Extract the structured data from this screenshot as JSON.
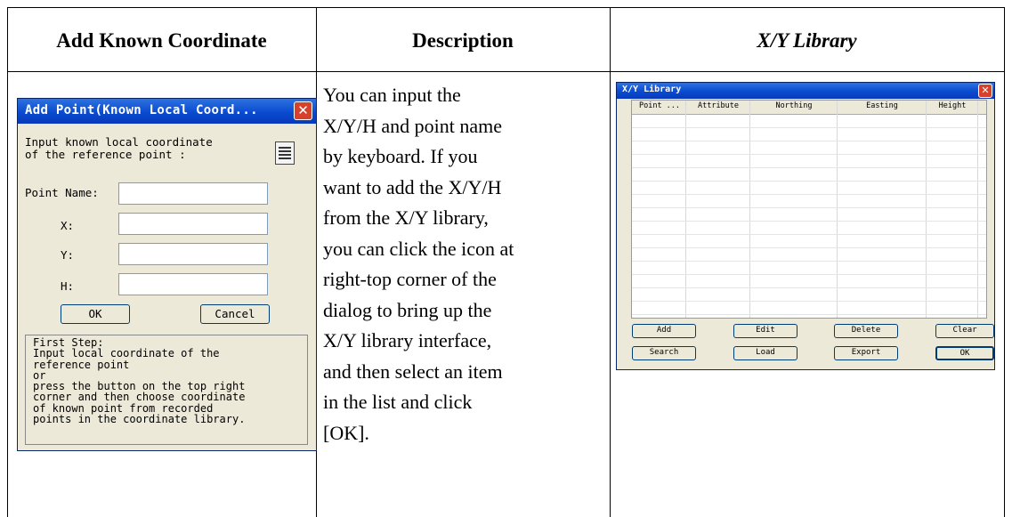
{
  "table": {
    "headers": [
      "Add Known Coordinate",
      "Description",
      "X/Y Library"
    ]
  },
  "description_lines": [
    "You can input the",
    "X/Y/H and point name",
    "by keyboard. If you",
    "want to add the X/Y/H",
    "from the X/Y library,",
    "you can click the icon at",
    "right-top corner of the",
    "dialog to bring up the",
    "X/Y library interface,",
    "and then select an item",
    "in the list and click",
    "[OK]."
  ],
  "add_point_dialog": {
    "title": "Add Point(Known Local Coord...",
    "prompt_lines": [
      "Input known local coordinate",
      "of the reference point :"
    ],
    "icon": "library-list-icon",
    "fields": [
      {
        "label": "Point Name:",
        "value": ""
      },
      {
        "label": "X:",
        "value": ""
      },
      {
        "label": "Y:",
        "value": ""
      },
      {
        "label": "H:",
        "value": ""
      }
    ],
    "ok_label": "OK",
    "cancel_label": "Cancel",
    "note_lines": [
      "First Step:",
      "Input local coordinate of the",
      "reference point",
      "or",
      "press the button on the top right",
      "corner and then choose coordinate",
      "of known point from recorded",
      "points in the coordinate library."
    ]
  },
  "library_dialog": {
    "title": "X/Y Library",
    "columns": [
      "Point ...",
      "Attribute",
      "Northing",
      "Easting",
      "Height"
    ],
    "buttons_row1": [
      "Add",
      "Edit",
      "Delete",
      "Clear"
    ],
    "buttons_row2": [
      "Search",
      "Load",
      "Export",
      "OK"
    ]
  },
  "colors": {
    "titlebar": "#0a4bd0",
    "dialog_bg": "#ece9d8",
    "close_button": "#d7412c"
  }
}
